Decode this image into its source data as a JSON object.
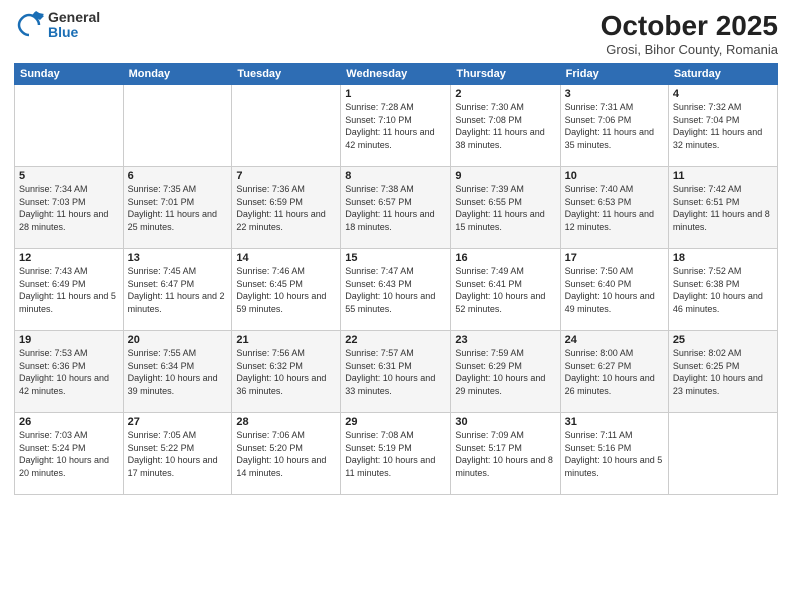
{
  "logo": {
    "general": "General",
    "blue": "Blue"
  },
  "header": {
    "month": "October 2025",
    "location": "Grosi, Bihor County, Romania"
  },
  "weekdays": [
    "Sunday",
    "Monday",
    "Tuesday",
    "Wednesday",
    "Thursday",
    "Friday",
    "Saturday"
  ],
  "weeks": [
    [
      {
        "day": "",
        "sunrise": "",
        "sunset": "",
        "daylight": ""
      },
      {
        "day": "",
        "sunrise": "",
        "sunset": "",
        "daylight": ""
      },
      {
        "day": "",
        "sunrise": "",
        "sunset": "",
        "daylight": ""
      },
      {
        "day": "1",
        "sunrise": "Sunrise: 7:28 AM",
        "sunset": "Sunset: 7:10 PM",
        "daylight": "Daylight: 11 hours and 42 minutes."
      },
      {
        "day": "2",
        "sunrise": "Sunrise: 7:30 AM",
        "sunset": "Sunset: 7:08 PM",
        "daylight": "Daylight: 11 hours and 38 minutes."
      },
      {
        "day": "3",
        "sunrise": "Sunrise: 7:31 AM",
        "sunset": "Sunset: 7:06 PM",
        "daylight": "Daylight: 11 hours and 35 minutes."
      },
      {
        "day": "4",
        "sunrise": "Sunrise: 7:32 AM",
        "sunset": "Sunset: 7:04 PM",
        "daylight": "Daylight: 11 hours and 32 minutes."
      }
    ],
    [
      {
        "day": "5",
        "sunrise": "Sunrise: 7:34 AM",
        "sunset": "Sunset: 7:03 PM",
        "daylight": "Daylight: 11 hours and 28 minutes."
      },
      {
        "day": "6",
        "sunrise": "Sunrise: 7:35 AM",
        "sunset": "Sunset: 7:01 PM",
        "daylight": "Daylight: 11 hours and 25 minutes."
      },
      {
        "day": "7",
        "sunrise": "Sunrise: 7:36 AM",
        "sunset": "Sunset: 6:59 PM",
        "daylight": "Daylight: 11 hours and 22 minutes."
      },
      {
        "day": "8",
        "sunrise": "Sunrise: 7:38 AM",
        "sunset": "Sunset: 6:57 PM",
        "daylight": "Daylight: 11 hours and 18 minutes."
      },
      {
        "day": "9",
        "sunrise": "Sunrise: 7:39 AM",
        "sunset": "Sunset: 6:55 PM",
        "daylight": "Daylight: 11 hours and 15 minutes."
      },
      {
        "day": "10",
        "sunrise": "Sunrise: 7:40 AM",
        "sunset": "Sunset: 6:53 PM",
        "daylight": "Daylight: 11 hours and 12 minutes."
      },
      {
        "day": "11",
        "sunrise": "Sunrise: 7:42 AM",
        "sunset": "Sunset: 6:51 PM",
        "daylight": "Daylight: 11 hours and 8 minutes."
      }
    ],
    [
      {
        "day": "12",
        "sunrise": "Sunrise: 7:43 AM",
        "sunset": "Sunset: 6:49 PM",
        "daylight": "Daylight: 11 hours and 5 minutes."
      },
      {
        "day": "13",
        "sunrise": "Sunrise: 7:45 AM",
        "sunset": "Sunset: 6:47 PM",
        "daylight": "Daylight: 11 hours and 2 minutes."
      },
      {
        "day": "14",
        "sunrise": "Sunrise: 7:46 AM",
        "sunset": "Sunset: 6:45 PM",
        "daylight": "Daylight: 10 hours and 59 minutes."
      },
      {
        "day": "15",
        "sunrise": "Sunrise: 7:47 AM",
        "sunset": "Sunset: 6:43 PM",
        "daylight": "Daylight: 10 hours and 55 minutes."
      },
      {
        "day": "16",
        "sunrise": "Sunrise: 7:49 AM",
        "sunset": "Sunset: 6:41 PM",
        "daylight": "Daylight: 10 hours and 52 minutes."
      },
      {
        "day": "17",
        "sunrise": "Sunrise: 7:50 AM",
        "sunset": "Sunset: 6:40 PM",
        "daylight": "Daylight: 10 hours and 49 minutes."
      },
      {
        "day": "18",
        "sunrise": "Sunrise: 7:52 AM",
        "sunset": "Sunset: 6:38 PM",
        "daylight": "Daylight: 10 hours and 46 minutes."
      }
    ],
    [
      {
        "day": "19",
        "sunrise": "Sunrise: 7:53 AM",
        "sunset": "Sunset: 6:36 PM",
        "daylight": "Daylight: 10 hours and 42 minutes."
      },
      {
        "day": "20",
        "sunrise": "Sunrise: 7:55 AM",
        "sunset": "Sunset: 6:34 PM",
        "daylight": "Daylight: 10 hours and 39 minutes."
      },
      {
        "day": "21",
        "sunrise": "Sunrise: 7:56 AM",
        "sunset": "Sunset: 6:32 PM",
        "daylight": "Daylight: 10 hours and 36 minutes."
      },
      {
        "day": "22",
        "sunrise": "Sunrise: 7:57 AM",
        "sunset": "Sunset: 6:31 PM",
        "daylight": "Daylight: 10 hours and 33 minutes."
      },
      {
        "day": "23",
        "sunrise": "Sunrise: 7:59 AM",
        "sunset": "Sunset: 6:29 PM",
        "daylight": "Daylight: 10 hours and 29 minutes."
      },
      {
        "day": "24",
        "sunrise": "Sunrise: 8:00 AM",
        "sunset": "Sunset: 6:27 PM",
        "daylight": "Daylight: 10 hours and 26 minutes."
      },
      {
        "day": "25",
        "sunrise": "Sunrise: 8:02 AM",
        "sunset": "Sunset: 6:25 PM",
        "daylight": "Daylight: 10 hours and 23 minutes."
      }
    ],
    [
      {
        "day": "26",
        "sunrise": "Sunrise: 7:03 AM",
        "sunset": "Sunset: 5:24 PM",
        "daylight": "Daylight: 10 hours and 20 minutes."
      },
      {
        "day": "27",
        "sunrise": "Sunrise: 7:05 AM",
        "sunset": "Sunset: 5:22 PM",
        "daylight": "Daylight: 10 hours and 17 minutes."
      },
      {
        "day": "28",
        "sunrise": "Sunrise: 7:06 AM",
        "sunset": "Sunset: 5:20 PM",
        "daylight": "Daylight: 10 hours and 14 minutes."
      },
      {
        "day": "29",
        "sunrise": "Sunrise: 7:08 AM",
        "sunset": "Sunset: 5:19 PM",
        "daylight": "Daylight: 10 hours and 11 minutes."
      },
      {
        "day": "30",
        "sunrise": "Sunrise: 7:09 AM",
        "sunset": "Sunset: 5:17 PM",
        "daylight": "Daylight: 10 hours and 8 minutes."
      },
      {
        "day": "31",
        "sunrise": "Sunrise: 7:11 AM",
        "sunset": "Sunset: 5:16 PM",
        "daylight": "Daylight: 10 hours and 5 minutes."
      },
      {
        "day": "",
        "sunrise": "",
        "sunset": "",
        "daylight": ""
      }
    ]
  ]
}
